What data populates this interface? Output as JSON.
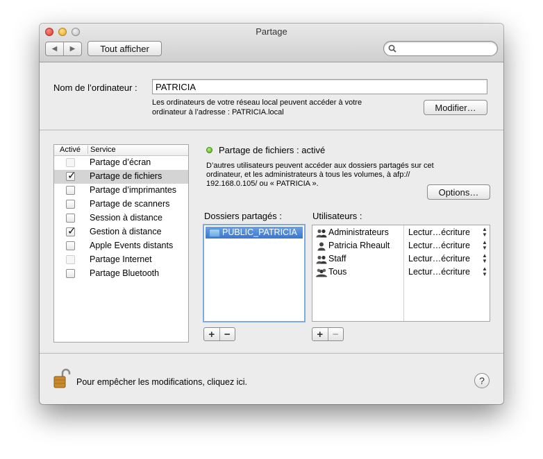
{
  "window": {
    "title": "Partage"
  },
  "toolbar": {
    "back_label": "◀",
    "forward_label": "▶",
    "show_all_label": "Tout afficher",
    "search_placeholder": ""
  },
  "computer": {
    "name_label": "Nom de l’ordinateur :",
    "name_value": "PATRICIA",
    "info_line1": "Les ordinateurs de votre réseau local peuvent accéder à votre",
    "info_line2": "ordinateur à l’adresse : PATRICIA.local",
    "modify_label": "Modifier…"
  },
  "services": {
    "col_active": "Activé",
    "col_service": "Service",
    "items": [
      {
        "label": "Partage d’écran",
        "checked": false,
        "dim": true
      },
      {
        "label": "Partage de fichiers",
        "checked": true,
        "dim": false,
        "selected": true
      },
      {
        "label": "Partage d’imprimantes",
        "checked": false,
        "dim": false
      },
      {
        "label": "Partage de scanners",
        "checked": false,
        "dim": false
      },
      {
        "label": "Session à distance",
        "checked": false,
        "dim": false
      },
      {
        "label": "Gestion à distance",
        "checked": true,
        "dim": false
      },
      {
        "label": "Apple Events distants",
        "checked": false,
        "dim": false
      },
      {
        "label": "Partage Internet",
        "checked": false,
        "dim": true
      },
      {
        "label": "Partage Bluetooth",
        "checked": false,
        "dim": false
      }
    ]
  },
  "detail": {
    "status": "Partage de fichiers : activé",
    "desc_line1": "D’autres utilisateurs peuvent accéder aux dossiers partagés sur cet",
    "desc_line2": "ordinateur, et les administrateurs à tous les volumes, à afp://",
    "desc_line3": "192.168.0.105/ ou « PATRICIA ».",
    "options_label": "Options…",
    "status_color": "#4aa516",
    "folders_label": "Dossiers partagés :",
    "folders": [
      "PUBLIC_PATRICIA"
    ],
    "users_label": "Utilisateurs :",
    "users": [
      {
        "name": "Administrateurs",
        "perm": "Lectur…écriture",
        "icon": "group-icon"
      },
      {
        "name": "Patricia Rheault",
        "perm": "Lectur…écriture",
        "icon": "user-icon"
      },
      {
        "name": "Staff",
        "perm": "Lectur…écriture",
        "icon": "group-icon"
      },
      {
        "name": "Tous",
        "perm": "Lectur…écriture",
        "icon": "everyone-icon"
      }
    ],
    "plus": "+",
    "minus": "−"
  },
  "footer": {
    "lock_text": "Pour empêcher les modifications, cliquez ici.",
    "help_label": "?"
  },
  "colors": {
    "selection": "#3a76cf",
    "selected_row": "#d4d4d4"
  }
}
